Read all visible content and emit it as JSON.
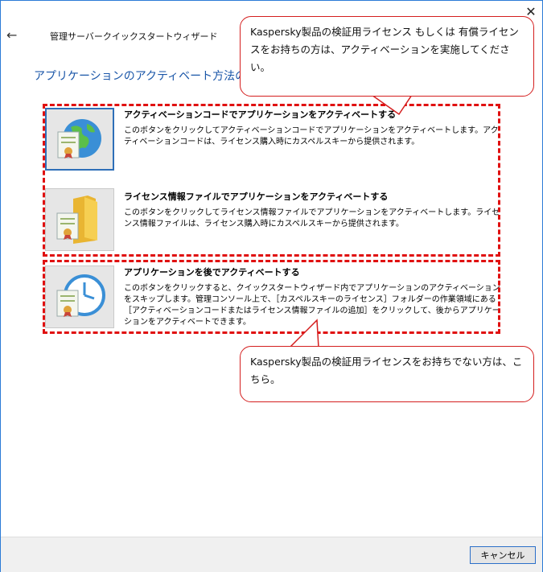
{
  "window": {
    "title": "管理サーバークイックスタートウィザード"
  },
  "page": {
    "heading": "アプリケーションのアクティベート方法の選択"
  },
  "options": [
    {
      "title": "アクティベーションコードでアプリケーションをアクティベートする",
      "description": "このボタンをクリックしてアクティベーションコードでアプリケーションをアクティベートします。アクティベーションコードは、ライセンス購入時にカスペルスキーから提供されます。",
      "icon": "globe-certificate-icon"
    },
    {
      "title": "ライセンス情報ファイルでアプリケーションをアクティベートする",
      "description": "このボタンをクリックしてライセンス情報ファイルでアプリケーションをアクティベートします。ライセンス情報ファイルは、ライセンス購入時にカスペルスキーから提供されます。",
      "icon": "folder-certificate-icon"
    },
    {
      "title": "アプリケーションを後でアクティベートする",
      "description": "このボタンをクリックすると、クイックスタートウィザード内でアプリケーションのアクティベーションをスキップします。管理コンソール上で、［カスペルスキーのライセンス］フォルダーの作業領域にある［アクティベーションコードまたはライセンス情報ファイルの追加］をクリックして、後からアプリケーションをアクティベートできます。",
      "icon": "clock-certificate-icon"
    }
  ],
  "callouts": {
    "licensed": "Kaspersky製品の検証用ライセンス もしくは 有償ライセンスをお持ちの方は、アクティベーションを実施してください。",
    "unlicensed": "Kaspersky製品の検証用ライセンスをお持ちでない方は、こちら。"
  },
  "footer": {
    "cancel_label": "キャンセル"
  },
  "colors": {
    "accent": "#2b7bd6",
    "heading": "#1a56a8",
    "annotation": "#e01010"
  }
}
